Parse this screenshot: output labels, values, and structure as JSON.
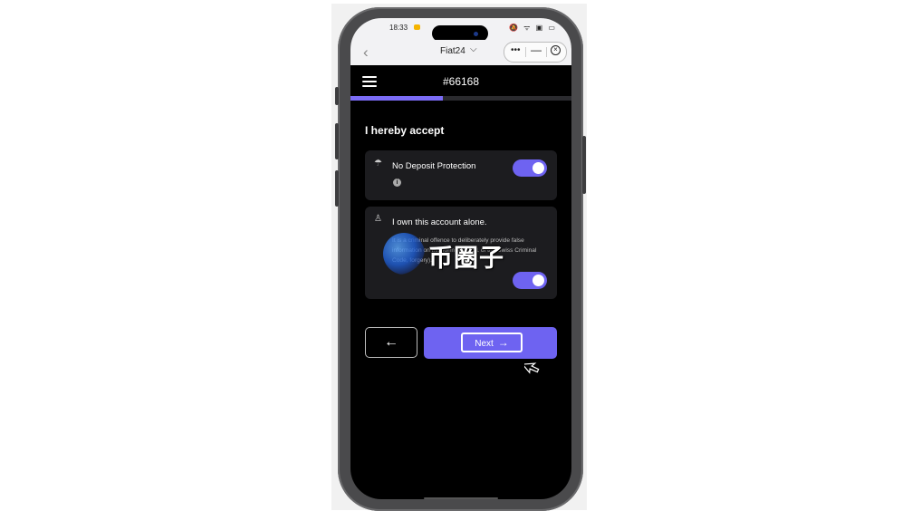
{
  "status_bar": {
    "time": "18:33",
    "icons": "🔕 ᯤ ▣ ▭"
  },
  "mini_app_bar": {
    "back": "‹",
    "app_name": "Fiat24",
    "app_chevron": "⌵",
    "more": "•••",
    "minimize": "—",
    "close": "×"
  },
  "header": {
    "title": "#66168"
  },
  "progress": {
    "fraction": 0.42,
    "color": "#7b6cf6"
  },
  "form": {
    "section_title": "I hereby accept",
    "items": [
      {
        "icon": "umbrella-icon",
        "glyph": "☂",
        "title": "No Deposit Protection",
        "info": "i",
        "checked": true
      },
      {
        "icon": "person-icon",
        "glyph": "♙",
        "title": "I own this account alone.",
        "description": "It is a criminal offence to deliberately provide false information on this form (Art. 251 of the Swiss Criminal Code, forgery).",
        "checked": true
      }
    ]
  },
  "buttons": {
    "back": "←",
    "next": "Next",
    "next_arrow": "→"
  },
  "watermark": {
    "text": "币圈子"
  },
  "colors": {
    "accent": "#6e63f1",
    "screen_bg": "#000000",
    "card_bg": "#1c1c1f"
  }
}
